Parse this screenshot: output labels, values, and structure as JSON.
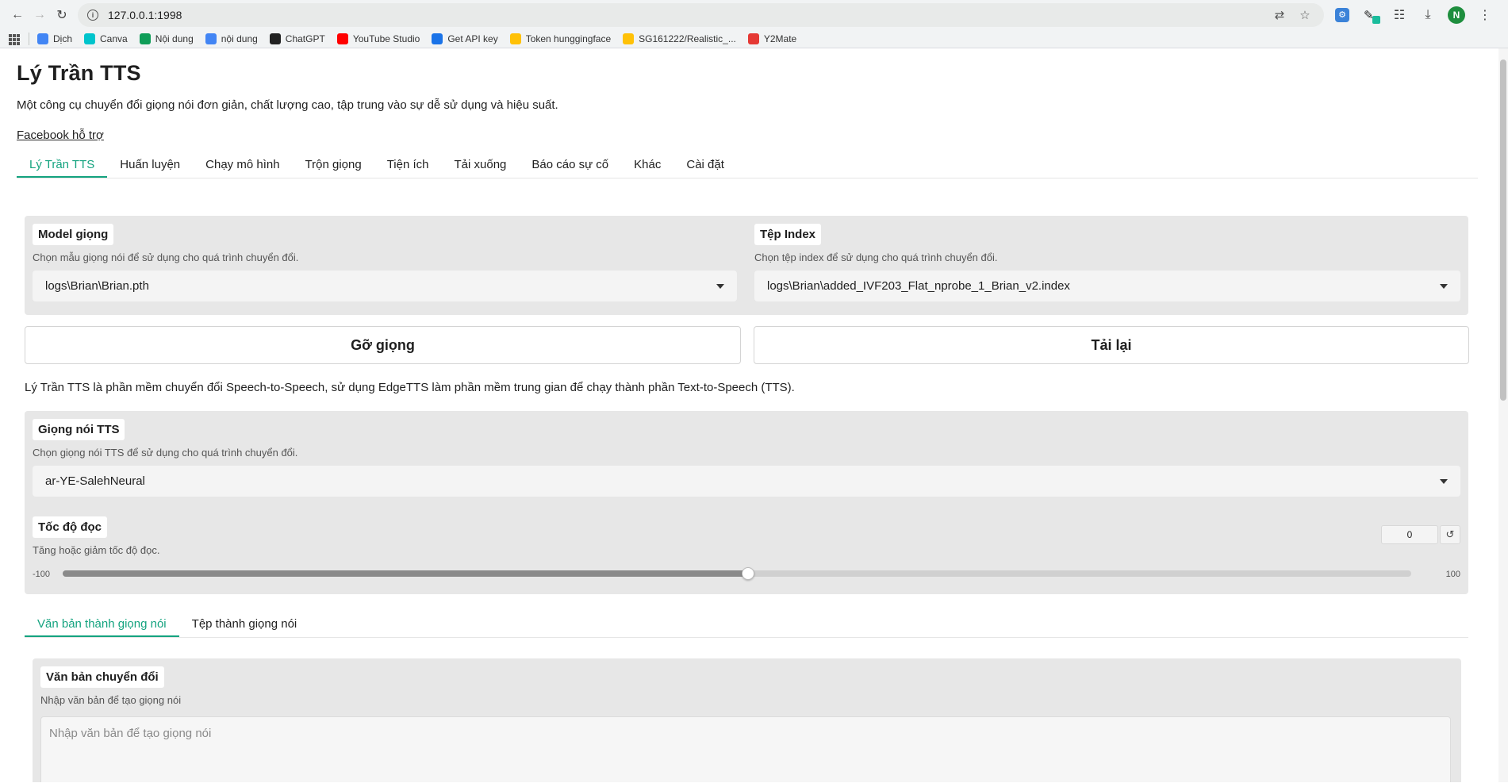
{
  "browser": {
    "url": "127.0.0.1:1998",
    "profile_initial": "N",
    "bookmarks": [
      {
        "label": "Dịch",
        "icon": "google-translate-icon",
        "color": "#4285f4"
      },
      {
        "label": "Canva",
        "icon": "canva-icon",
        "color": "#00c4cc"
      },
      {
        "label": "Nội dung",
        "icon": "google-sheets-icon",
        "color": "#0f9d58"
      },
      {
        "label": "nội dung",
        "icon": "google-docs-icon",
        "color": "#4285f4"
      },
      {
        "label": "ChatGPT",
        "icon": "chatgpt-icon",
        "color": "#222222"
      },
      {
        "label": "YouTube Studio",
        "icon": "youtube-icon",
        "color": "#ff0000"
      },
      {
        "label": "Get API key",
        "icon": "api-icon",
        "color": "#1a73e8"
      },
      {
        "label": "Token hunggingface",
        "icon": "huggingface-icon",
        "color": "#ffc107"
      },
      {
        "label": "SG161222/Realistic_...",
        "icon": "huggingface-icon",
        "color": "#ffc107"
      },
      {
        "label": "Y2Mate",
        "icon": "y2mate-icon",
        "color": "#e53935"
      }
    ]
  },
  "app": {
    "title": "Lý Trần TTS",
    "description": "Một công cụ chuyển đổi giọng nói đơn giản, chất lượng cao, tập trung vào sự dễ sử dụng và hiệu suất.",
    "facebook_link": "Facebook hỗ trợ",
    "tabs": [
      "Lý Trần TTS",
      "Huấn luyện",
      "Chạy mô hình",
      "Trộn giọng",
      "Tiện ích",
      "Tải xuống",
      "Báo cáo sự cố",
      "Khác",
      "Cài đặt"
    ],
    "active_tab": 0
  },
  "model": {
    "label": "Model giọng",
    "desc": "Chọn mẫu giọng nói để sử dụng cho quá trình chuyển đổi.",
    "value": "logs\\Brian\\Brian.pth"
  },
  "index": {
    "label": "Tệp Index",
    "desc": "Chọn tệp index để sử dụng cho quá trình chuyển đổi.",
    "value": "logs\\Brian\\added_IVF203_Flat_nprobe_1_Brian_v2.index"
  },
  "buttons": {
    "unload": "Gỡ giọng",
    "refresh": "Tải lại"
  },
  "info_text": "Lý Trần TTS là phần mềm chuyển đổi Speech-to-Speech, sử dụng EdgeTTS làm phần mềm trung gian để chạy thành phần Text-to-Speech (TTS).",
  "tts_voice": {
    "label": "Giọng nói TTS",
    "desc": "Chọn giọng nói TTS để sử dụng cho quá trình chuyển đổi.",
    "value": "ar-YE-SalehNeural"
  },
  "speed": {
    "label": "Tốc độ đọc",
    "desc": "Tăng hoặc giảm tốc độ đọc.",
    "value": "0",
    "min": "-100",
    "max": "100"
  },
  "sub_tabs": [
    "Văn bản thành giọng nói",
    "Tệp thành giọng nói"
  ],
  "text_input": {
    "label": "Văn bản chuyển đổi",
    "desc": "Nhập văn bản để tạo giọng nói",
    "placeholder": "Nhập văn bản để tạo giọng nói"
  }
}
